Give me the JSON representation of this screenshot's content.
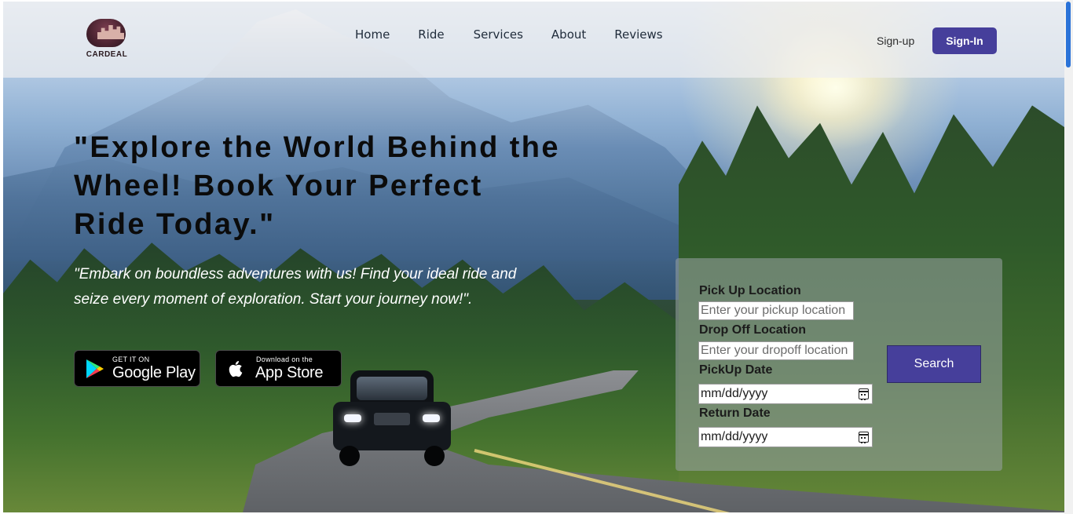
{
  "brand": {
    "name": "CARDEAL"
  },
  "nav": {
    "links": [
      {
        "label": "Home"
      },
      {
        "label": "Ride"
      },
      {
        "label": "Services"
      },
      {
        "label": "About"
      },
      {
        "label": "Reviews"
      }
    ],
    "signup_label": "Sign-up",
    "signin_label": "Sign-In"
  },
  "hero": {
    "headline": "\"Explore the World Behind the Wheel! Book Your Perfect Ride Today.\"",
    "subline": "\"Embark on boundless adventures with us! Find your ideal ride and seize every moment of exploration. Start your journey now!\"."
  },
  "stores": {
    "google_play": {
      "small": "GET IT ON",
      "big": "Google Play"
    },
    "app_store": {
      "small": "Download on the",
      "big": "App Store"
    }
  },
  "booking": {
    "pickup_location": {
      "label": "Pick Up Location",
      "placeholder": "Enter your pickup location"
    },
    "dropoff_location": {
      "label": "Drop Off Location",
      "placeholder": "Enter your dropoff location"
    },
    "pickup_date": {
      "label": "PickUp Date",
      "value": "mm/dd/yyyy"
    },
    "return_date": {
      "label": "Return Date",
      "value": "mm/dd/yyyy"
    },
    "search_label": "Search"
  },
  "colors": {
    "accent": "#463f9b",
    "scroll_thumb": "#2b73d8"
  },
  "icons": {
    "logo": "car-city-logo-icon",
    "google_play": "google-play-icon",
    "app_store": "apple-icon",
    "calendar": "calendar-icon"
  }
}
